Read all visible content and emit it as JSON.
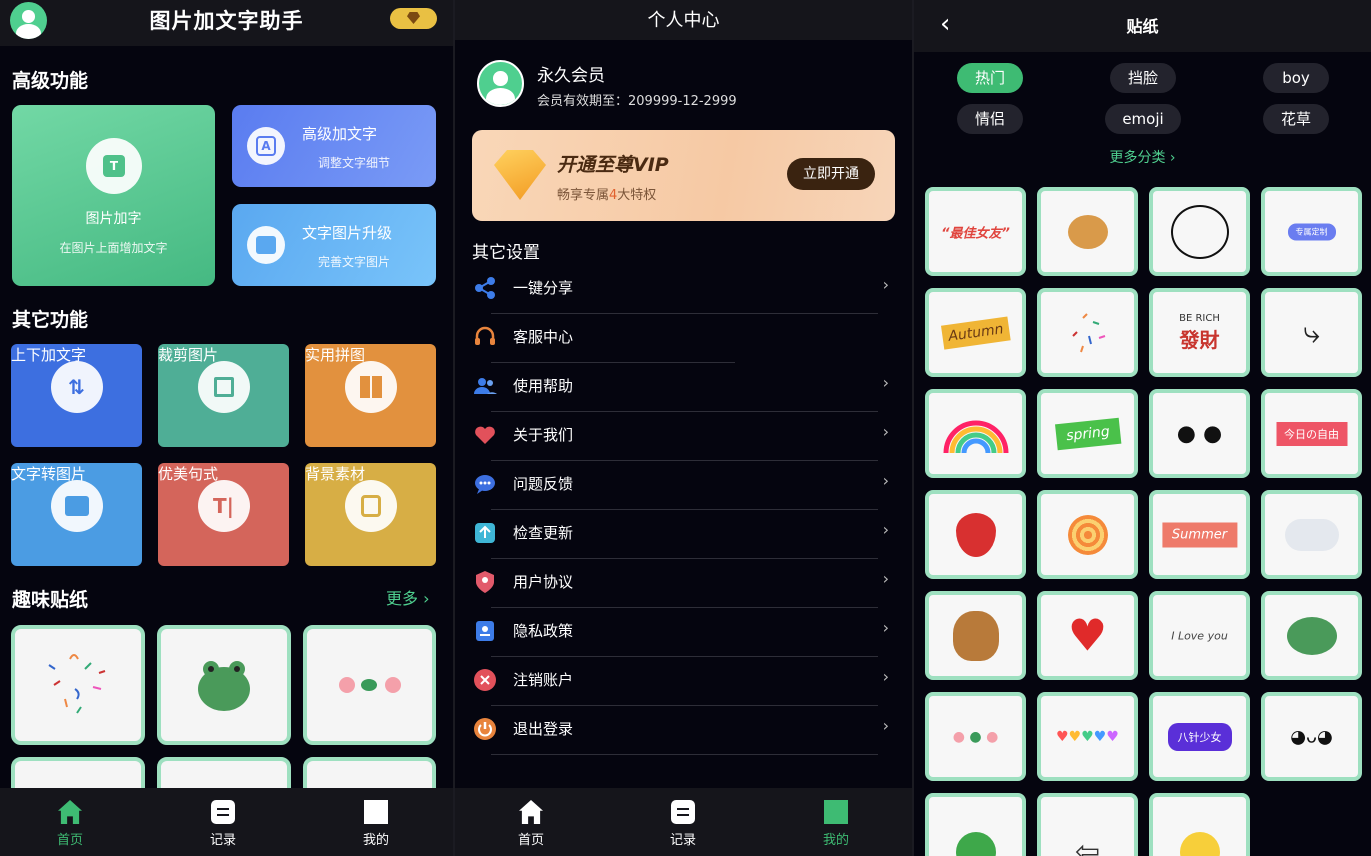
{
  "home": {
    "title": "图片加文字助手",
    "section_advanced": "高级功能",
    "main_card": {
      "title": "图片加字",
      "sub": "在图片上面增加文字",
      "glyph": "T"
    },
    "card_advanced_text": {
      "title": "高级加文字",
      "sub": "调整文字细节",
      "glyph": "A"
    },
    "card_upgrade": {
      "title": "文字图片升级",
      "sub": "完善文字图片"
    },
    "section_other": "其它功能",
    "tools": [
      {
        "label": "上下加文字",
        "color": "#3d6fe0"
      },
      {
        "label": "裁剪图片",
        "color": "#4fae96"
      },
      {
        "label": "实用拼图",
        "color": "#e2913e"
      },
      {
        "label": "文字转图片",
        "color": "#4b9ce3"
      },
      {
        "label": "优美句式",
        "color": "#d4655b"
      },
      {
        "label": "背景素材",
        "color": "#d7ae45"
      }
    ],
    "section_stickers": "趣味贴纸",
    "more": "更多 ›",
    "nav": {
      "home": "首页",
      "records": "记录",
      "mine": "我的"
    }
  },
  "profile": {
    "title": "个人中心",
    "member_name": "永久会员",
    "member_expiry": "会员有效期至：209999-12-2999",
    "vip_title": "开通至尊VIP",
    "vip_sub_before": "畅享专属",
    "vip_sub_num": "4",
    "vip_sub_after": "大特权",
    "vip_button": "立即开通",
    "other_settings": "其它设置",
    "menu": [
      {
        "label": "一键分享",
        "icon": "share-icon",
        "color": "#3d7ce8"
      },
      {
        "label": "客服中心",
        "icon": "headset-icon",
        "color": "#e8843d"
      },
      {
        "label": "使用帮助",
        "icon": "users-icon",
        "color": "#3d7ce8"
      },
      {
        "label": "关于我们",
        "icon": "heart-icon",
        "color": "#e2515b"
      },
      {
        "label": "问题反馈",
        "icon": "chat-icon",
        "color": "#3d6fe0"
      },
      {
        "label": "检查更新",
        "icon": "upload-icon",
        "color": "#3fb6d6"
      },
      {
        "label": "用户协议",
        "icon": "shield-icon",
        "color": "#e25a6b"
      },
      {
        "label": "隐私政策",
        "icon": "id-card-icon",
        "color": "#3d7ce8"
      },
      {
        "label": "注销账户",
        "icon": "close-circle-icon",
        "color": "#e2515b"
      },
      {
        "label": "退出登录",
        "icon": "power-icon",
        "color": "#e8843d"
      }
    ],
    "arrow": "›",
    "nav": {
      "home": "首页",
      "records": "记录",
      "mine": "我的"
    }
  },
  "stickers": {
    "title": "贴纸",
    "back": "‹",
    "categories": [
      "热门",
      "挡脸",
      "boy",
      "情侣",
      "emoji",
      "花草"
    ],
    "more_categories": "更多分类 ›",
    "text_stickers": {
      "best_gf": "“最佳女友”",
      "vip_custom": "专属定制",
      "autumn": "Autumn",
      "be_rich_en": "BE RICH",
      "be_rich_cn": "發財",
      "spring": "spring",
      "today_free": "今日の自由",
      "summer": "Summer",
      "love_you": "I Love you",
      "gentle_girl": "八针少女"
    }
  }
}
